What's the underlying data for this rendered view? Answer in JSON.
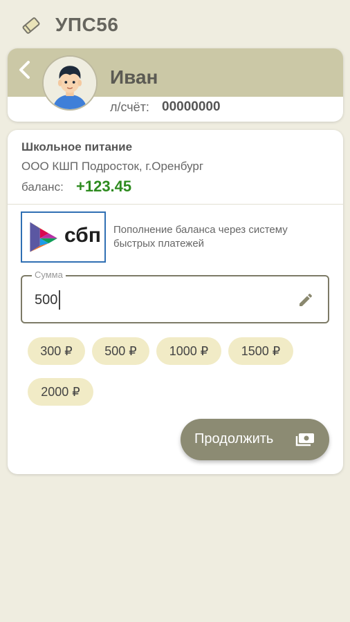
{
  "app": {
    "title": "УПС56",
    "logo_icon": "card-tag-icon"
  },
  "user": {
    "back_icon": "chevron-left-icon",
    "avatar_icon": "boy-avatar-icon",
    "name": "Иван",
    "account_label": "л/счёт:",
    "account_value": "00000000"
  },
  "service": {
    "title": "Школьное питание",
    "organization": "ООО КШП Подросток, г.Оренбург",
    "balance_label": "баланс:",
    "balance_value": "+123.45"
  },
  "sbp": {
    "logo_text": "сбп",
    "description": "Пополнение баланса через систему быстрых платежей"
  },
  "amount": {
    "legend": "Сумма",
    "value": "500",
    "edit_icon": "pencil-icon"
  },
  "quick_amounts": [
    "300 ₽",
    "500 ₽",
    "1000 ₽",
    "1500 ₽",
    "2000 ₽"
  ],
  "continue": {
    "label": "Продолжить",
    "icon": "cash-icon"
  },
  "colors": {
    "background": "#efede0",
    "header_band": "#cbc8a6",
    "balance_positive": "#2e8b1f",
    "chip": "#f1ebc6",
    "button": "#8c8b73"
  }
}
